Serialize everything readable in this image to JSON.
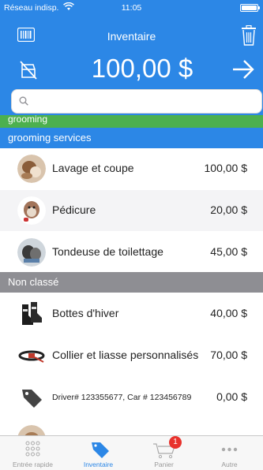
{
  "status": {
    "carrier": "Réseau indisp.",
    "time": "11:05"
  },
  "header": {
    "title": "Inventaire",
    "total": "100,00 $"
  },
  "search": {
    "placeholder": "",
    "value": ""
  },
  "categories": {
    "grooming": "grooming",
    "grooming_services": "grooming services",
    "non_classe": "Non classé"
  },
  "items": [
    {
      "name": "Lavage et coupe",
      "price": "100,00 $"
    },
    {
      "name": "Pédicure",
      "price": "20,00 $"
    },
    {
      "name": "Tondeuse de toilettage",
      "price": "45,00 $"
    },
    {
      "name": "Bottes d'hiver",
      "price": "40,00 $"
    },
    {
      "name": "Collier et liasse personnalisés",
      "price": "70,00 $"
    },
    {
      "name": "Driver# 123355677, Car # 123456789",
      "price": "0,00 $"
    }
  ],
  "tabbar": {
    "tabs": [
      {
        "label": "Entrée rapide"
      },
      {
        "label": "Inventaire"
      },
      {
        "label": "Panier",
        "badge": "1"
      },
      {
        "label": "Autre"
      }
    ]
  },
  "colors": {
    "accent": "#2c87e6",
    "green": "#4cb04e",
    "gray": "#8e8e93",
    "badge": "#e8322d"
  }
}
